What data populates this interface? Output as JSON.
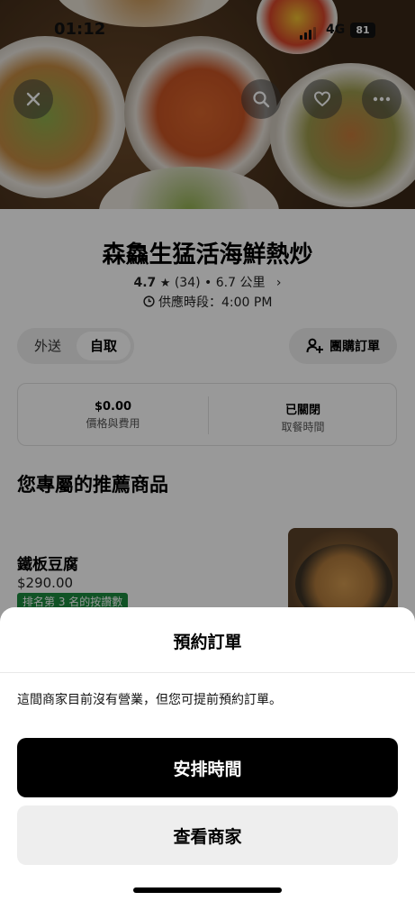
{
  "status_bar": {
    "time": "01:12",
    "network": "4G",
    "battery": "81"
  },
  "store": {
    "name": "森鱻生猛活海鮮熱炒",
    "rating": "4.7",
    "review_count": "(34)",
    "distance": "6.7 公里",
    "hours": "供應時段：4:00 PM"
  },
  "mode_toggle": {
    "delivery": "外送",
    "pickup": "自取",
    "selected": "自取"
  },
  "group_order_label": "團購訂單",
  "info": {
    "price_value": "$0.00",
    "price_label": "價格與費用",
    "pickup_value": "已關閉",
    "pickup_label": "取餐時間"
  },
  "recommended": {
    "title": "您專屬的推薦商品",
    "items": [
      {
        "name": "鐵板豆腐",
        "price": "$290.00",
        "badge": "排名第 3 名的按讚數"
      }
    ]
  },
  "sheet": {
    "title": "預約訂單",
    "message": "這間商家目前沒有營業，但您可提前預約訂單。",
    "primary_label": "安排時間",
    "secondary_label": "查看商家"
  },
  "icons": {
    "close": "close-icon",
    "search": "search-icon",
    "favorite": "heart-icon",
    "more": "more-icon",
    "clock": "clock-icon",
    "group": "add-person-icon",
    "star": "star-icon"
  },
  "colors": {
    "badge_green": "#1b8a3e",
    "primary_button": "#000000",
    "secondary_button": "#eeeeee"
  }
}
